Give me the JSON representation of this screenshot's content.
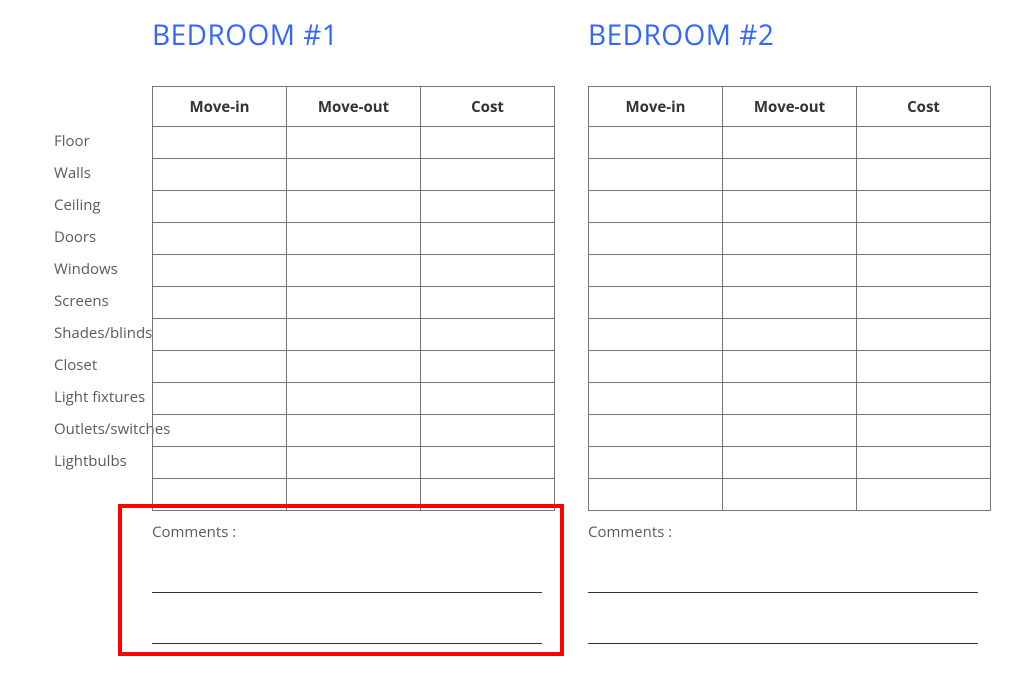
{
  "titles": {
    "bedroom1": "BEDROOM #1",
    "bedroom2": "BEDROOM #2"
  },
  "columns": [
    "Move-in",
    "Move-out",
    "Cost"
  ],
  "rowLabels": [
    "Floor",
    "Walls",
    "Ceiling",
    "Doors",
    "Windows",
    "Screens",
    "Shades/blinds",
    "Closet",
    "Light fixtures",
    "Outlets/switches",
    "Lightbulbs"
  ],
  "extraBlankRows": 1,
  "tables": {
    "bedroom1": {
      "cells": [
        [
          "",
          "",
          ""
        ],
        [
          "",
          "",
          ""
        ],
        [
          "",
          "",
          ""
        ],
        [
          "",
          "",
          ""
        ],
        [
          "",
          "",
          ""
        ],
        [
          "",
          "",
          ""
        ],
        [
          "",
          "",
          ""
        ],
        [
          "",
          "",
          ""
        ],
        [
          "",
          "",
          ""
        ],
        [
          "",
          "",
          ""
        ],
        [
          "",
          "",
          ""
        ],
        [
          "",
          "",
          ""
        ]
      ]
    },
    "bedroom2": {
      "cells": [
        [
          "",
          "",
          ""
        ],
        [
          "",
          "",
          ""
        ],
        [
          "",
          "",
          ""
        ],
        [
          "",
          "",
          ""
        ],
        [
          "",
          "",
          ""
        ],
        [
          "",
          "",
          ""
        ],
        [
          "",
          "",
          ""
        ],
        [
          "",
          "",
          ""
        ],
        [
          "",
          "",
          ""
        ],
        [
          "",
          "",
          ""
        ],
        [
          "",
          "",
          ""
        ],
        [
          "",
          "",
          ""
        ]
      ]
    }
  },
  "comments": {
    "label": "Comments :",
    "lines": 2
  }
}
